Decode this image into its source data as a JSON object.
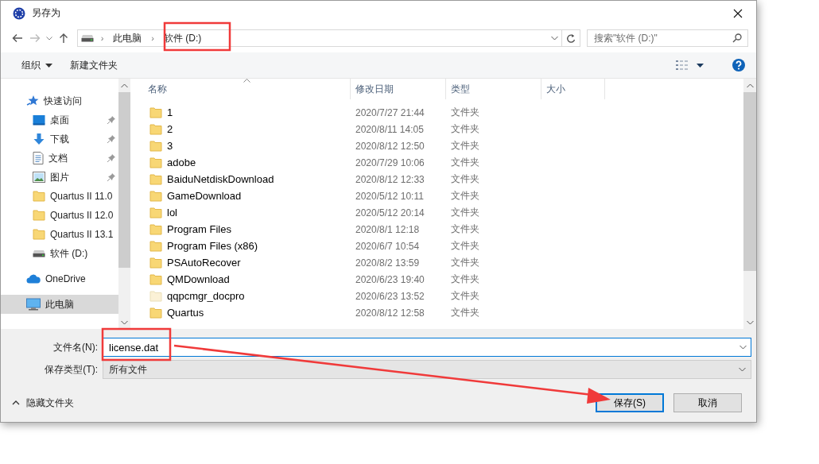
{
  "window": {
    "title": "另存为"
  },
  "address": {
    "path": [
      {
        "separator": "›",
        "label": "此电脑"
      },
      {
        "separator": "›",
        "label": "软件 (D:)"
      }
    ]
  },
  "search": {
    "placeholder": "搜索\"软件 (D:)\""
  },
  "toolbar": {
    "organize": "组织",
    "new_folder": "新建文件夹"
  },
  "sidebar": {
    "items": [
      {
        "label": "快速访问",
        "kind": "star",
        "pinned": false,
        "selected": false,
        "children": [
          {
            "label": "桌面",
            "kind": "desktop",
            "pinned": true,
            "selected": false
          },
          {
            "label": "下载",
            "kind": "download",
            "pinned": true,
            "selected": false
          },
          {
            "label": "文档",
            "kind": "document",
            "pinned": true,
            "selected": false
          },
          {
            "label": "图片",
            "kind": "image",
            "pinned": true,
            "selected": false
          },
          {
            "label": "Quartus II 11.0",
            "kind": "folder",
            "pinned": false,
            "selected": false
          },
          {
            "label": "Quartus II 12.0",
            "kind": "folder",
            "pinned": false,
            "selected": false
          },
          {
            "label": "Quartus II 13.1",
            "kind": "folder",
            "pinned": false,
            "selected": false
          },
          {
            "label": "软件 (D:)",
            "kind": "drive",
            "pinned": false,
            "selected": false
          }
        ]
      },
      {
        "label": "OneDrive",
        "kind": "cloud",
        "pinned": false,
        "selected": false
      },
      {
        "label": "此电脑",
        "kind": "computer",
        "pinned": false,
        "selected": true
      }
    ]
  },
  "files": {
    "columns": [
      "名称",
      "修改日期",
      "类型",
      "大小"
    ],
    "rows": [
      {
        "name": "1",
        "date": "2020/7/27 21:44",
        "type": "文件夹",
        "hidden": false
      },
      {
        "name": "2",
        "date": "2020/8/11 14:05",
        "type": "文件夹",
        "hidden": false
      },
      {
        "name": "3",
        "date": "2020/8/12 12:50",
        "type": "文件夹",
        "hidden": false
      },
      {
        "name": "adobe",
        "date": "2020/7/29 10:06",
        "type": "文件夹",
        "hidden": false
      },
      {
        "name": "BaiduNetdiskDownload",
        "date": "2020/8/12 12:33",
        "type": "文件夹",
        "hidden": false
      },
      {
        "name": "GameDownload",
        "date": "2020/5/12 10:11",
        "type": "文件夹",
        "hidden": false
      },
      {
        "name": "lol",
        "date": "2020/5/12 20:14",
        "type": "文件夹",
        "hidden": false
      },
      {
        "name": "Program Files",
        "date": "2020/8/1 12:18",
        "type": "文件夹",
        "hidden": false
      },
      {
        "name": "Program Files (x86)",
        "date": "2020/6/7 10:54",
        "type": "文件夹",
        "hidden": false
      },
      {
        "name": "PSAutoRecover",
        "date": "2020/8/2 13:59",
        "type": "文件夹",
        "hidden": false
      },
      {
        "name": "QMDownload",
        "date": "2020/6/23 19:40",
        "type": "文件夹",
        "hidden": false
      },
      {
        "name": "qqpcmgr_docpro",
        "date": "2020/6/23 13:52",
        "type": "文件夹",
        "hidden": true
      },
      {
        "name": "Quartus",
        "date": "2020/8/12 12:58",
        "type": "文件夹",
        "hidden": false
      }
    ]
  },
  "footer": {
    "filename": {
      "label": "文件名(N):",
      "value": "license.dat"
    },
    "filetype": {
      "label": "保存类型(T):",
      "value": "所有文件"
    },
    "hide_folders": "隐藏文件夹",
    "buttons": [
      {
        "label": "保存(S)",
        "default": true
      },
      {
        "label": "取消",
        "default": false
      }
    ]
  },
  "annotations": [
    {
      "kind": "box"
    },
    {
      "kind": "box"
    },
    {
      "kind": "arrow"
    }
  ]
}
